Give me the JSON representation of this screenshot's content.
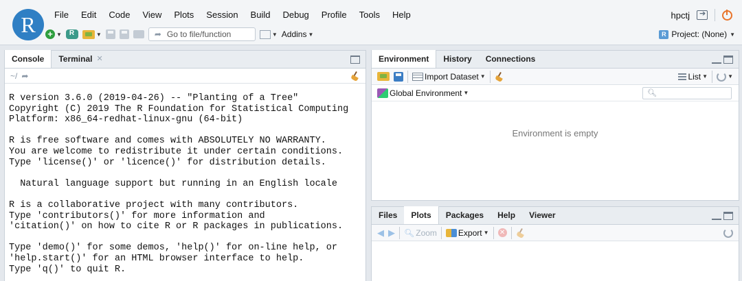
{
  "menubar": [
    "File",
    "Edit",
    "Code",
    "View",
    "Plots",
    "Session",
    "Build",
    "Debug",
    "Profile",
    "Tools",
    "Help"
  ],
  "user": {
    "name": "hpctj"
  },
  "logo": {
    "letter": "R"
  },
  "toolbar": {
    "goto_placeholder": "Go to file/function",
    "addins_label": "Addins"
  },
  "project": {
    "label": "Project: (None)"
  },
  "console_pane": {
    "tabs": [
      {
        "label": "Console",
        "active": true
      },
      {
        "label": "Terminal",
        "active": false
      }
    ],
    "path": "~/",
    "lines": [
      "R version 3.6.0 (2019-04-26) -- \"Planting of a Tree\"",
      "Copyright (C) 2019 The R Foundation for Statistical Computing",
      "Platform: x86_64-redhat-linux-gnu (64-bit)",
      "",
      "R is free software and comes with ABSOLUTELY NO WARRANTY.",
      "You are welcome to redistribute it under certain conditions.",
      "Type 'license()' or 'licence()' for distribution details.",
      "",
      "  Natural language support but running in an English locale",
      "",
      "R is a collaborative project with many contributors.",
      "Type 'contributors()' for more information and",
      "'citation()' on how to cite R or R packages in publications.",
      "",
      "Type 'demo()' for some demos, 'help()' for on-line help, or",
      "'help.start()' for an HTML browser interface to help.",
      "Type 'q()' to quit R."
    ]
  },
  "env_pane": {
    "tabs": [
      {
        "label": "Environment",
        "active": true
      },
      {
        "label": "History",
        "active": false
      },
      {
        "label": "Connections",
        "active": false
      }
    ],
    "import_label": "Import Dataset",
    "list_label": "List",
    "global_env_label": "Global Environment",
    "empty_text": "Environment is empty"
  },
  "files_pane": {
    "tabs": [
      {
        "label": "Files",
        "active": false
      },
      {
        "label": "Plots",
        "active": true
      },
      {
        "label": "Packages",
        "active": false
      },
      {
        "label": "Help",
        "active": false
      },
      {
        "label": "Viewer",
        "active": false
      }
    ],
    "zoom_label": "Zoom",
    "export_label": "Export"
  }
}
